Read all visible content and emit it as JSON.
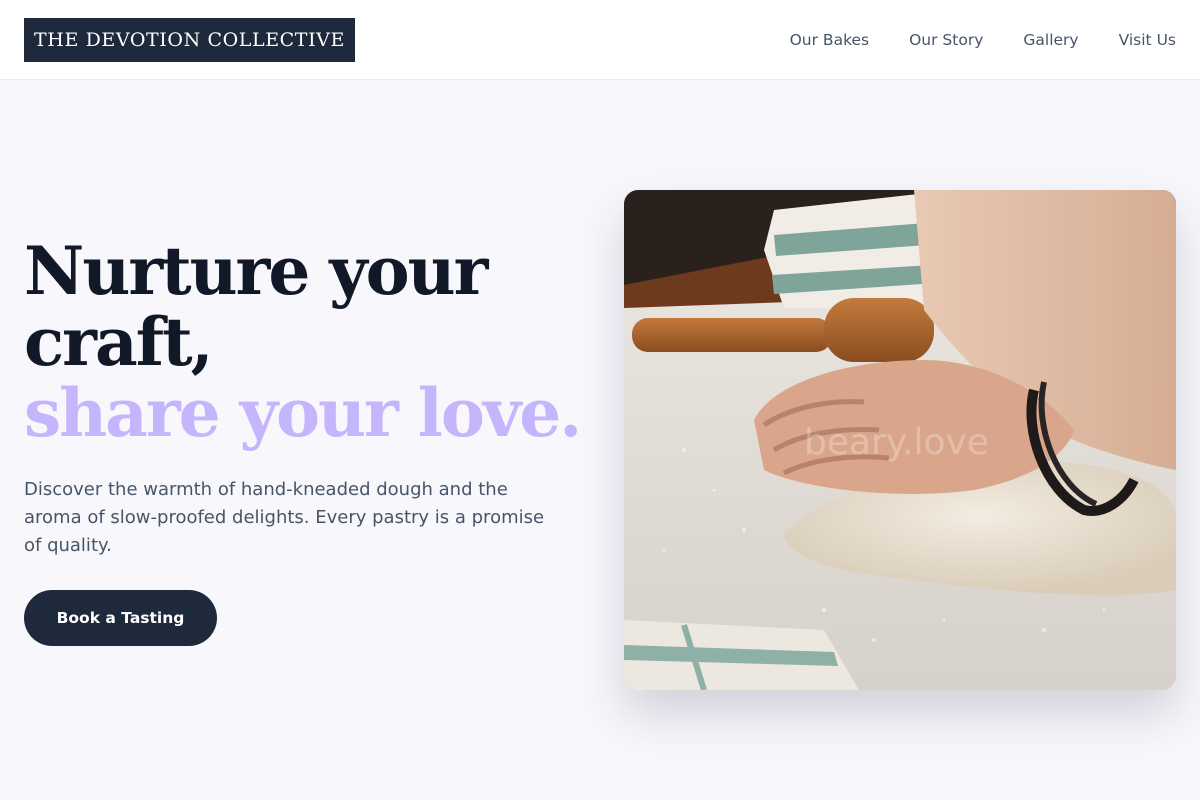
{
  "nav": {
    "logo": "THE DEVOTION COLLECTIVE",
    "links": [
      "Our Bakes",
      "Our Story",
      "Gallery",
      "Visit Us"
    ]
  },
  "hero": {
    "headline_line1": "Nurture your",
    "headline_line2": "craft,",
    "headline_line3": "share your love.",
    "description": "Discover the warmth of hand-kneaded dough and the aroma of slow-proofed delights. Every pastry is a promise of quality.",
    "cta_label": "Book a Tasting",
    "image_watermark": "beary.love"
  },
  "colors": {
    "primary_dark": "#1e293b",
    "accent_lavender": "#c4b5fd",
    "page_background": "#f8f7fc"
  },
  "icons": []
}
